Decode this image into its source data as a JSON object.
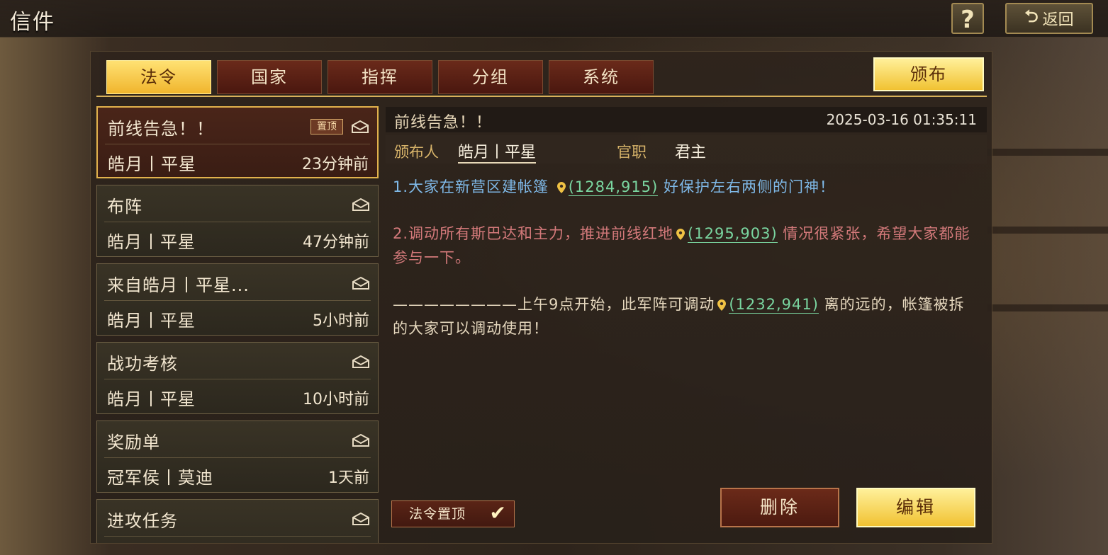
{
  "window": {
    "title": "信件"
  },
  "top_buttons": {
    "help_label": "?",
    "back_label": "返回"
  },
  "tabs": [
    {
      "label": "法令",
      "active": true
    },
    {
      "label": "国家",
      "active": false
    },
    {
      "label": "指挥",
      "active": false
    },
    {
      "label": "分组",
      "active": false
    },
    {
      "label": "系统",
      "active": false
    }
  ],
  "publish_label": "颁布",
  "mails": [
    {
      "title": "前线告急！！",
      "pinned_badge": "置顶",
      "sender": "皓月丨平星",
      "time": "23分钟前",
      "selected": true
    },
    {
      "title": "布阵",
      "sender": "皓月丨平星",
      "time": "47分钟前"
    },
    {
      "title": "来自皓月丨平星...",
      "sender": "皓月丨平星",
      "time": "5小时前"
    },
    {
      "title": "战功考核",
      "sender": "皓月丨平星",
      "time": "10小时前"
    },
    {
      "title": "奖励单",
      "sender": "冠军侯丨莫迪",
      "time": "1天前"
    },
    {
      "title": "进攻任务",
      "sender": "",
      "time": ""
    }
  ],
  "detail": {
    "subject": "前线告急！！",
    "date": "2025-03-16 01:35:11",
    "publisher_label": "颁布人",
    "publisher": "皓月丨平星",
    "position_label": "官职",
    "position": "君主",
    "p1_text_a": "1.大家在新营区建帐篷",
    "p1_coord": "(1284,915)",
    "p1_text_b": "好保护左右两侧的门神！",
    "p2_text_a": "2.调动所有斯巴达和主力，推进前线红地",
    "p2_coord": "(1295,903)",
    "p2_text_b": "情况很紧张，希望大家都能参与一下。",
    "p3_text_a": "————————上午9点开始，此军阵可调动",
    "p3_coord": "(1232,941)",
    "p3_text_b": "离的远的，帐篷被拆的大家可以调动使用！"
  },
  "pin_toggle_label": "法令置顶",
  "delete_label": "删除",
  "edit_label": "编辑",
  "colors": {
    "accent_gold": "#f1c232",
    "tab_red": "#6a2a1a",
    "text_blue": "#7fb9e8",
    "text_red": "#d3797a",
    "coord_green": "#7ad6a0"
  }
}
